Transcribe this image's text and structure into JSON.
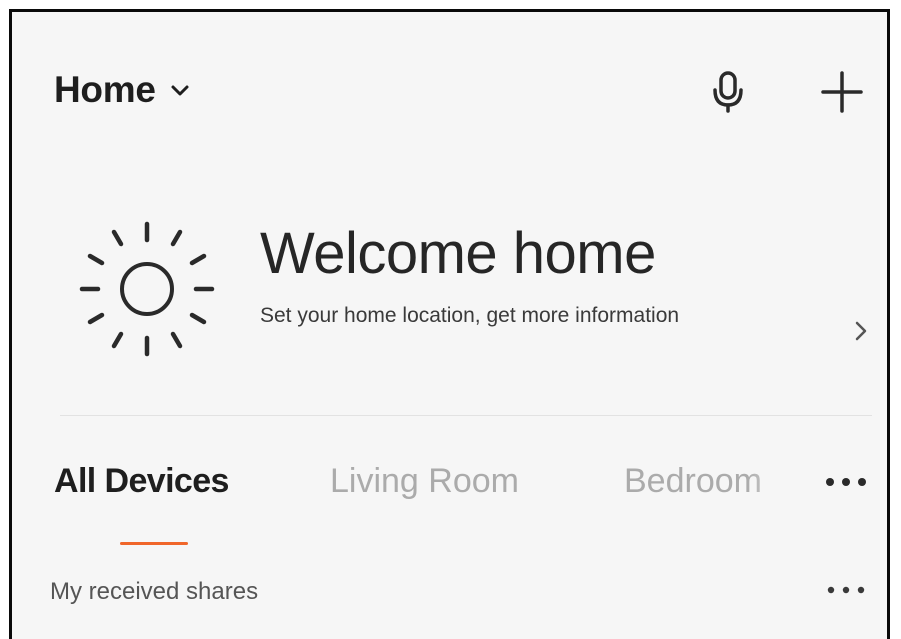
{
  "header": {
    "home_label": "Home",
    "dropdown_icon": "chevron-down-icon",
    "mic_icon": "microphone-icon",
    "add_icon": "plus-icon"
  },
  "welcome_card": {
    "icon": "sun-icon",
    "title": "Welcome home",
    "subtitle": "Set your home location, get more information",
    "chevron_icon": "chevron-right-icon"
  },
  "tabs": [
    {
      "label": "All Devices",
      "active": true
    },
    {
      "label": "Living Room",
      "active": false
    },
    {
      "label": "Bedroom",
      "active": false
    }
  ],
  "tabs_more_icon": "more-horizontal-icon",
  "shares": {
    "label": "My received shares",
    "more_icon": "more-horizontal-icon"
  },
  "colors": {
    "accent": "#f0662a",
    "background": "#f6f6f6",
    "text_primary": "#1e1e1e",
    "text_inactive": "#ababab"
  }
}
